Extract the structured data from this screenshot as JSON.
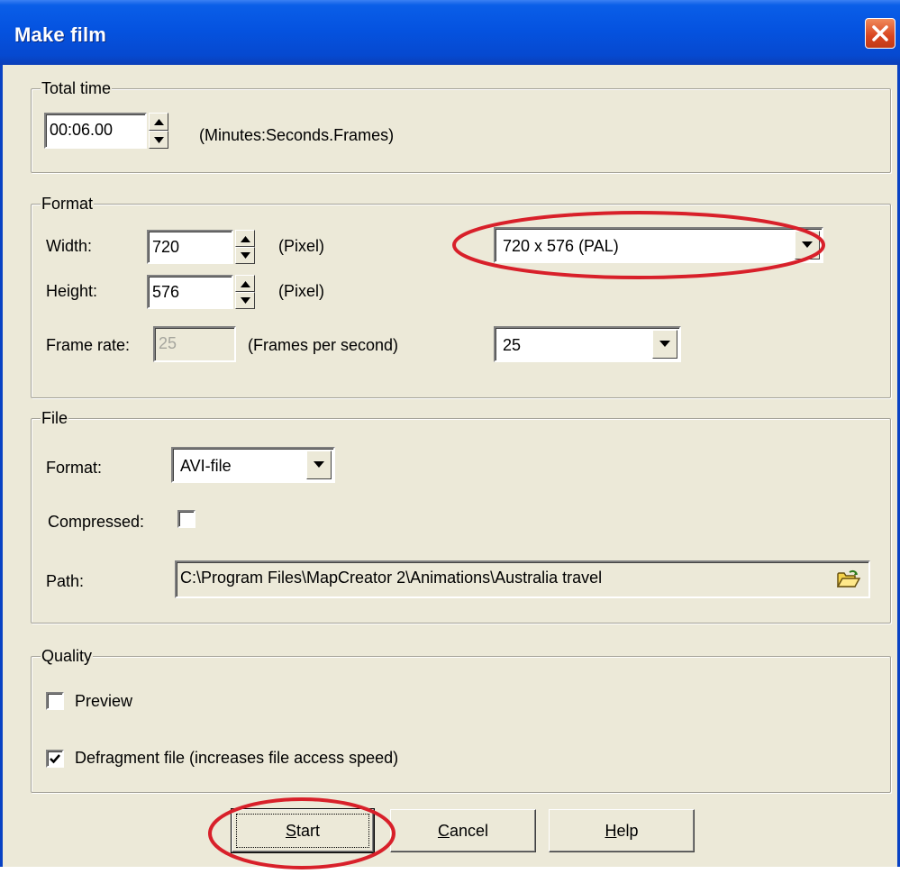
{
  "window": {
    "title": "Make film"
  },
  "total_time": {
    "legend": "Total time",
    "value": "00:06.00",
    "hint": "(Minutes:Seconds.Frames)"
  },
  "format": {
    "legend": "Format",
    "width_label": "Width:",
    "width_value": "720",
    "height_label": "Height:",
    "height_value": "576",
    "pixel_unit": "(Pixel)",
    "preset_value": "720 x 576  (PAL)",
    "frame_rate_label": "Frame rate:",
    "frame_rate_value": "25",
    "frame_rate_unit": "(Frames per second)",
    "frame_rate_select": "25"
  },
  "file": {
    "legend": "File",
    "format_label": "Format:",
    "format_value": "AVI-file",
    "compressed_label": "Compressed:",
    "compressed_checked": false,
    "path_label": "Path:",
    "path_value": "C:\\Program Files\\MapCreator 2\\Animations\\Australia travel"
  },
  "quality": {
    "legend": "Quality",
    "preview_label": "Preview",
    "preview_checked": false,
    "defragment_label": "Defragment file (increases file access speed)",
    "defragment_checked": true
  },
  "buttons": {
    "start_hotkey": "S",
    "start_rest": "tart",
    "cancel_hotkey": "C",
    "cancel_rest": "ancel",
    "help_hotkey": "H",
    "help_rest": "elp"
  },
  "colors": {
    "titlebar": "#0553e0",
    "dialog_bg": "#ece9d8",
    "highlight_oval": "#d8202a"
  }
}
